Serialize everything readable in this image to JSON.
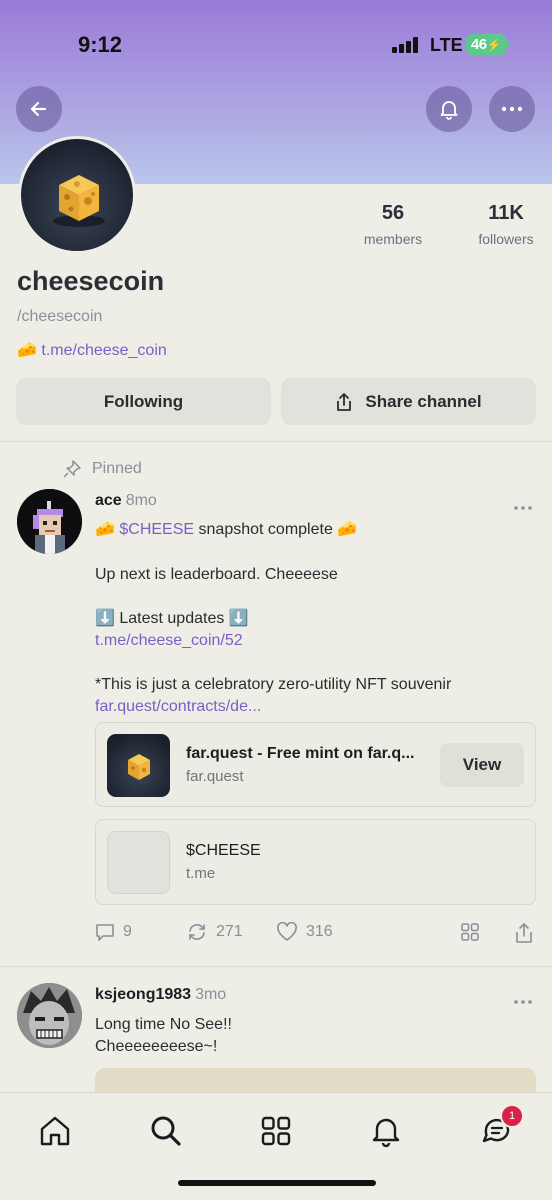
{
  "status_bar": {
    "time": "9:12",
    "network": "LTE",
    "battery": "46"
  },
  "channel": {
    "name": "cheesecoin",
    "handle": "/cheesecoin",
    "link_emoji": "🧀",
    "link": "t.me/cheese_coin",
    "stats": [
      {
        "value": "56",
        "label": "members"
      },
      {
        "value": "11K",
        "label": "followers"
      }
    ],
    "following_label": "Following",
    "share_label": "Share channel"
  },
  "pinned_label": "Pinned",
  "post1": {
    "author": "ace",
    "time": "8mo",
    "line1_emoji_left": "🧀",
    "line1_link": "$CHEESE",
    "line1_text": "snapshot complete",
    "line1_emoji_right": "🧀",
    "line2": "Up next is leaderboard. Cheeeese",
    "line3": "⬇️ Latest updates ⬇️",
    "line4_link": "t.me/cheese_coin/52",
    "line5": "*This is just a celebratory zero-utility NFT souvenir",
    "line6_link": "far.quest/contracts/de...",
    "embed1": {
      "title": "far.quest - Free mint on far.q...",
      "sub": "far.quest",
      "button": "View"
    },
    "embed2": {
      "title": "$CHEESE",
      "sub": "t.me"
    },
    "replies": "9",
    "recasts": "271",
    "likes": "316"
  },
  "post2": {
    "author": "ksjeong1983",
    "time": "3mo",
    "line1": "Long time No See!!",
    "line2": "Cheeeeeeeese~!"
  },
  "tab_bar": {
    "notification_badge": "1"
  },
  "icons": [
    "back-arrow-icon",
    "bell-icon",
    "more-icon",
    "pin-icon",
    "reply-icon",
    "recast-icon",
    "heart-icon",
    "grid-icon",
    "share-icon",
    "home-icon",
    "search-icon",
    "chat-icon"
  ]
}
